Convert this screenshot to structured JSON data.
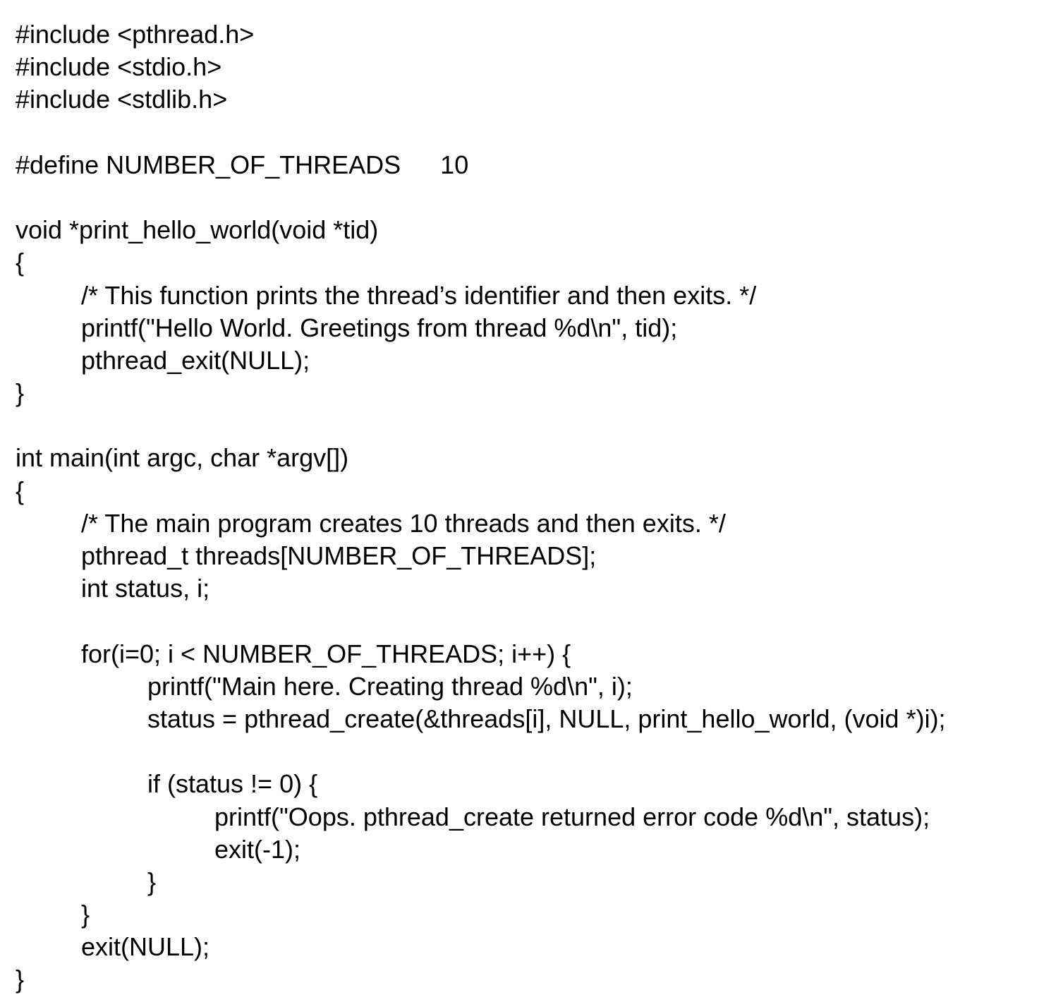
{
  "lines": [
    "#include <pthread.h>",
    "#include <stdio.h>",
    "#include <stdlib.h>",
    "",
    "#define NUMBER_OF_THREADS",
    "",
    "void *print_hello_world(void *tid)",
    "{",
    "/* This function prints the thread’s identifier and then exits. */",
    "printf(\"Hello World. Greetings from thread %d\\n\", tid);",
    "pthread_exit(NULL);",
    "}",
    "",
    "int main(int argc, char *argv[])",
    "{",
    "/* The main program creates 10 threads and then exits. */",
    "pthread_t threads[NUMBER_OF_THREADS];",
    "int status, i;",
    "",
    "for(i=0; i < NUMBER_OF_THREADS; i++) {",
    "printf(\"Main here. Creating thread %d\\n\", i);",
    "status = pthread_create(&threads[i], NULL, print_hello_world, (void *)i);",
    "",
    "if (status != 0) {",
    "printf(\"Oops. pthread_create returned error code %d\\n\", status);",
    "exit(-1);",
    "}",
    "}",
    "exit(NULL);",
    "}"
  ],
  "define_value": "10"
}
